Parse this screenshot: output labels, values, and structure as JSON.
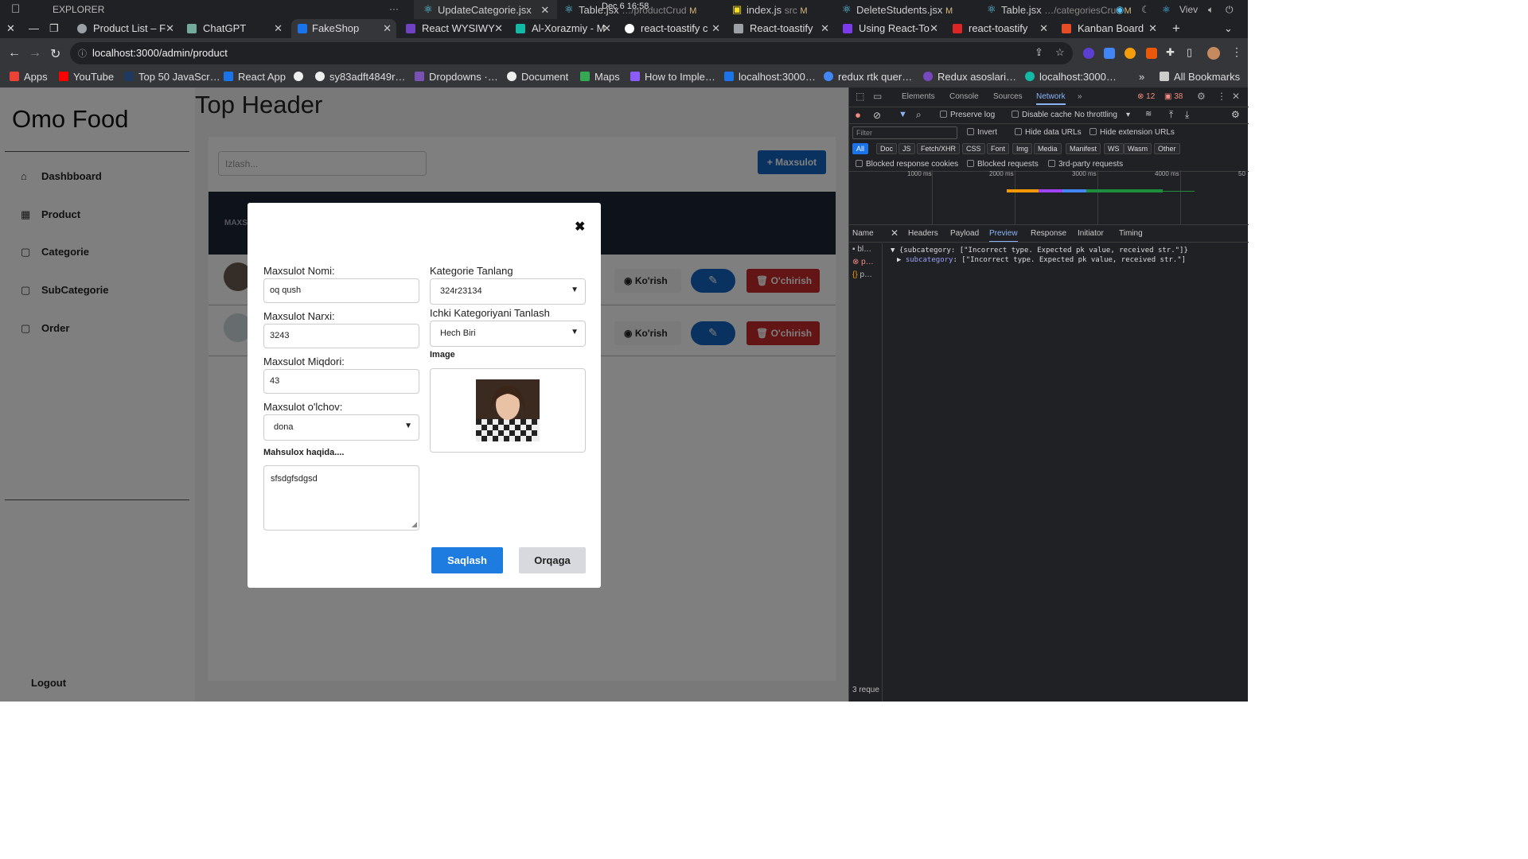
{
  "os_bar": {
    "explorer_label": "EXPLORER",
    "ellipsis": "···",
    "datetime": "Dec 6  16:58",
    "editor_tabs": [
      {
        "name": "UpdateCategorie.jsx",
        "dir": "",
        "mod": ""
      },
      {
        "name": "Table.jsx",
        "dir": "…/productCrud",
        "mod": "M"
      },
      {
        "name": "index.js",
        "dir": "src",
        "mod": "M"
      },
      {
        "name": "DeleteStudents.jsx",
        "dir": "",
        "mod": "M"
      },
      {
        "name": "Table.jsx",
        "dir": "…/categoriesCrud",
        "mod": "M"
      }
    ],
    "view_label": "Viev"
  },
  "browser_tabs": [
    {
      "title": "Product List – F",
      "color": "#9aa0a6"
    },
    {
      "title": "ChatGPT",
      "color": "#74aa9c"
    },
    {
      "title": "FakeShop",
      "color": "#1a73e8"
    },
    {
      "title": "React WYSIWY",
      "color": "#6f42c1"
    },
    {
      "title": "Al-Xorazmiy - M",
      "color": "#14b8a6"
    },
    {
      "title": "react-toastify c",
      "color": "#ffffff"
    },
    {
      "title": "React-toastify",
      "color": "#9aa0a6"
    },
    {
      "title": "Using React-To",
      "color": "#7c3aed"
    },
    {
      "title": "react-toastify",
      "color": "#dc2626"
    },
    {
      "title": "Kanban Board",
      "color": "#e44d26"
    }
  ],
  "address": {
    "url": "localhost:3000/admin/product"
  },
  "bookmarks": [
    {
      "label": "Apps",
      "color": "#ea4335"
    },
    {
      "label": "YouTube",
      "color": "#ff0000"
    },
    {
      "label": "Top 50 JavaScr…",
      "color": "#1e3a5f"
    },
    {
      "label": "React App",
      "color": "#1a73e8"
    },
    {
      "label": "",
      "color": "#eeeeee"
    },
    {
      "label": "sy83adft4849r…",
      "color": "#eeeeee"
    },
    {
      "label": "Dropdowns ·…",
      "color": "#7952b3"
    },
    {
      "label": "Document",
      "color": "#eeeeee"
    },
    {
      "label": "Maps",
      "color": "#34a853"
    },
    {
      "label": "How to Imple…",
      "color": "#8b5cf6"
    },
    {
      "label": "localhost:3000…",
      "color": "#1a73e8"
    },
    {
      "label": "redux rtk quer…",
      "color": "#4285f4"
    },
    {
      "label": "Redux asoslari…",
      "color": "#764abc"
    },
    {
      "label": "localhost:3000…",
      "color": "#14b8a6"
    }
  ],
  "all_bookmarks": "All Bookmarks",
  "app": {
    "brand": "Omo Food",
    "top_header": "Top Header",
    "sidebar": [
      {
        "label": "Dashbboard",
        "icon": "home-icon"
      },
      {
        "label": "Product",
        "icon": "grid-icon"
      },
      {
        "label": "Categorie",
        "icon": "bag-icon"
      },
      {
        "label": "SubCategorie",
        "icon": "bag-icon"
      },
      {
        "label": "Order",
        "icon": "bag-icon"
      }
    ],
    "logout": "Logout",
    "search_placeholder": "Izlash...",
    "add_button": "+ Maxsulot",
    "table_header": "MAXSU",
    "row_actions": {
      "view": "Ko'rish",
      "delete": "O'chirish"
    }
  },
  "modal": {
    "name_label": "Maxsulot Nomi:",
    "name_value": "oq qush",
    "price_label": "Maxsulot Narxi:",
    "price_value": "3243",
    "qty_label": "Maxsulot Miqdori:",
    "qty_value": "43",
    "unit_label": "Maxsulot o'lchov:",
    "unit_value": "dona",
    "desc_label": "Mahsulox haqida....",
    "desc_value": "sfsdgfsdgsd",
    "category_label": "Kategorie Tanlang",
    "category_value": "324r23134",
    "subcategory_label": "Ichki Kategoriyani Tanlash",
    "subcategory_value": "Hech Biri",
    "image_label": "Image",
    "save": "Saqlash",
    "back": "Orqaga"
  },
  "devtools": {
    "tabs": [
      "Elements",
      "Console",
      "Sources",
      "Network"
    ],
    "errors": "12",
    "warnings": "38",
    "preserve_log": "Preserve log",
    "disable_cache": "Disable cache",
    "throttling": "No throttling",
    "filter_placeholder": "Filter",
    "invert": "Invert",
    "hide_data_urls": "Hide data URLs",
    "hide_ext_urls": "Hide extension URLs",
    "type_filters": [
      "All",
      "Doc",
      "JS",
      "Fetch/XHR",
      "CSS",
      "Font",
      "Img",
      "Media",
      "Manifest",
      "WS",
      "Wasm",
      "Other"
    ],
    "blocked_cookies": "Blocked response cookies",
    "blocked_requests": "Blocked requests",
    "third_party": "3rd-party requests",
    "ticks": [
      "1000 ms",
      "2000 ms",
      "3000 ms",
      "4000 ms",
      "50"
    ],
    "detail_tabs": [
      "Headers",
      "Payload",
      "Preview",
      "Response",
      "Initiator",
      "Timing"
    ],
    "name_col": "Name",
    "requests": [
      "bl…",
      "p…",
      "p…"
    ],
    "preview_line1": "▼ {subcategory: [\"Incorrect type. Expected pk value, received str.\"]}",
    "preview_key": "subcategory",
    "preview_line2": ": [\"Incorrect type. Expected pk value, received str.\"]",
    "footer": "3 reque"
  }
}
